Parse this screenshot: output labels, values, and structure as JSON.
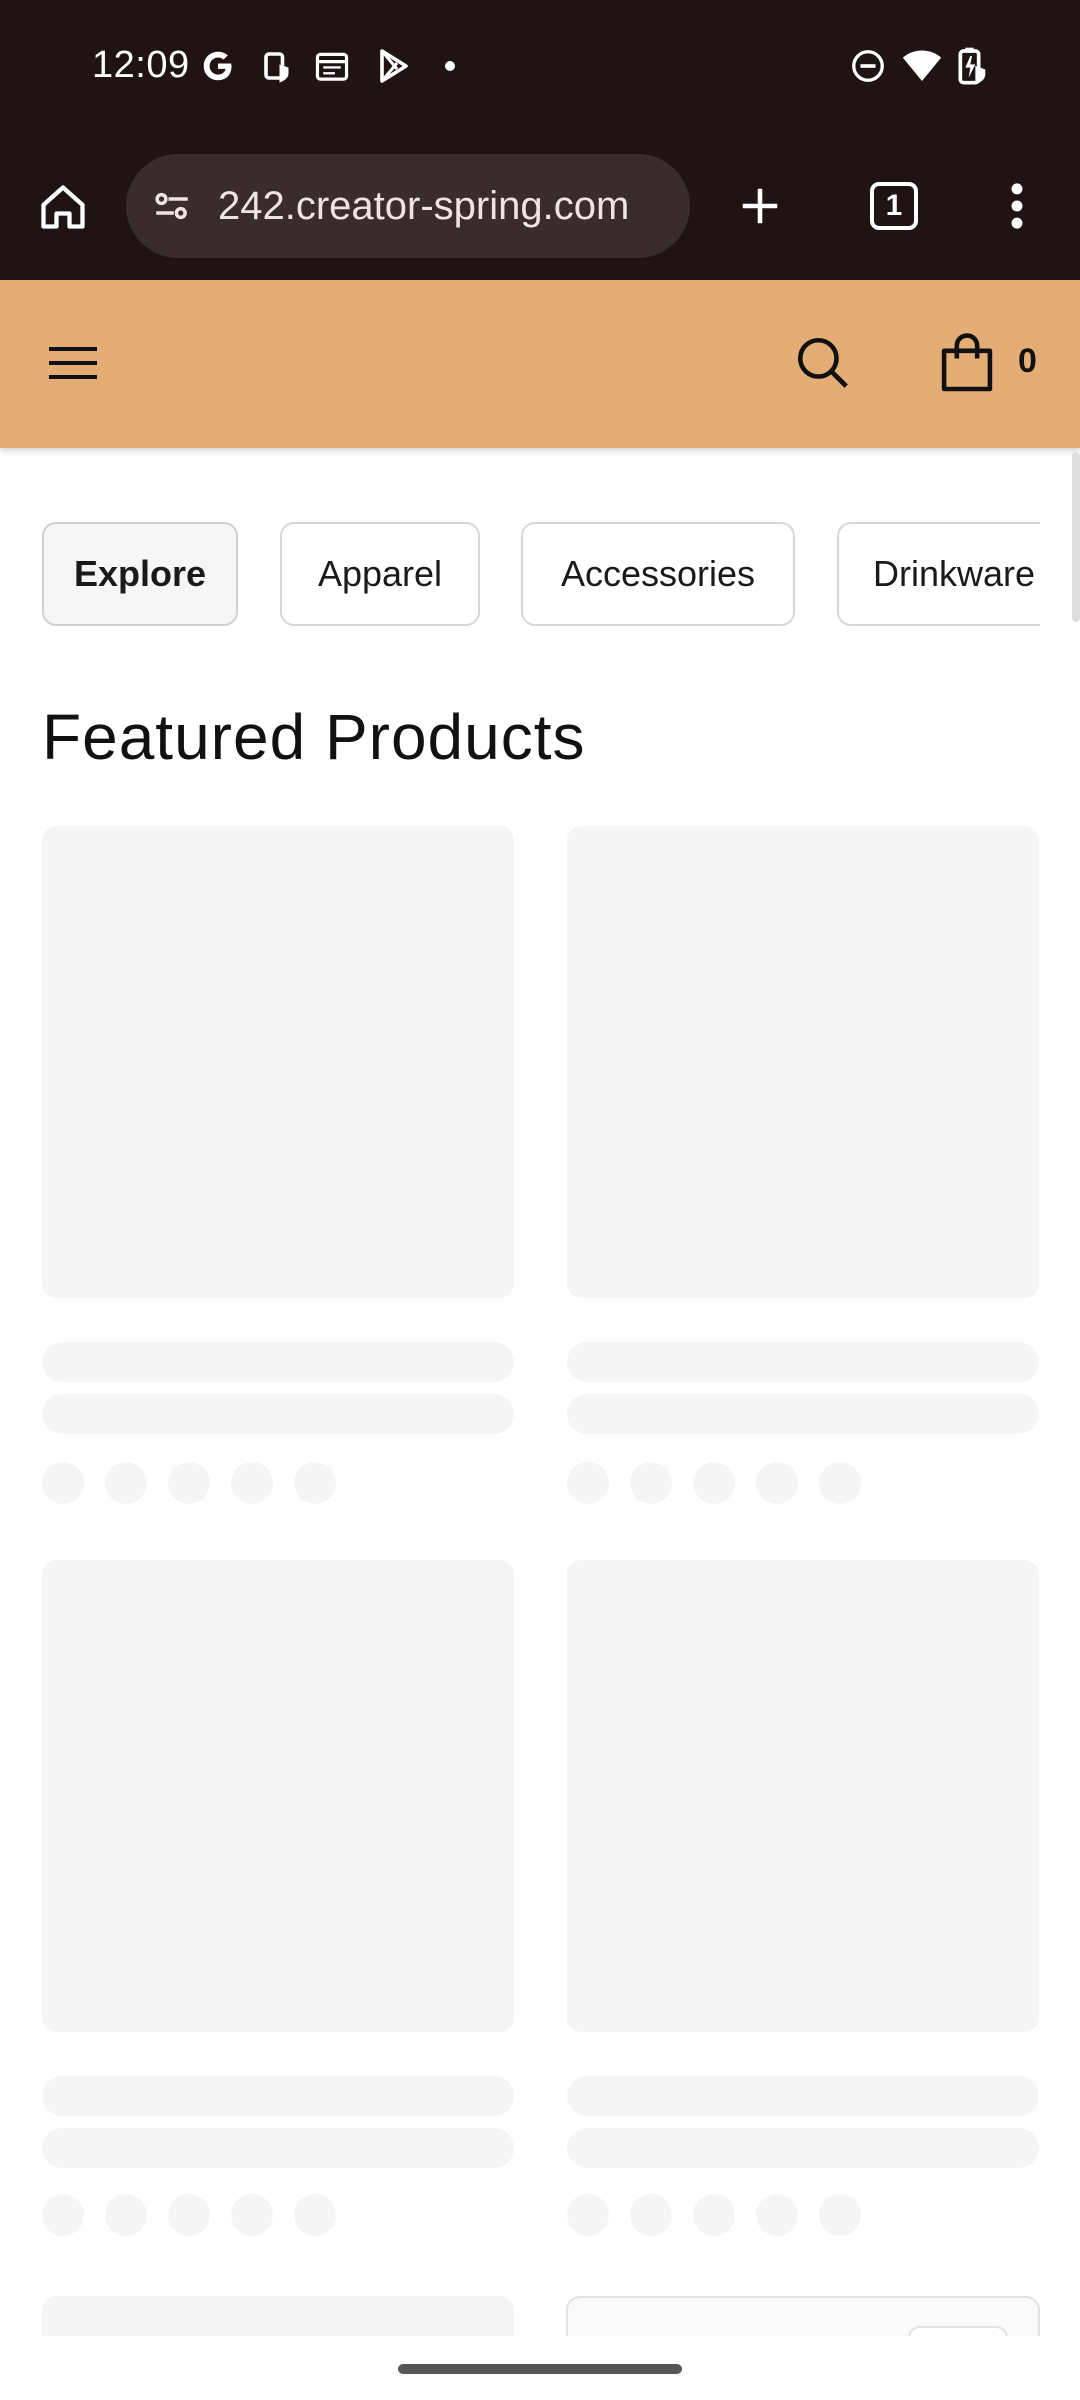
{
  "status_bar": {
    "time": "12:09",
    "left_icons": [
      "google-g-icon",
      "clipboard-shield-icon",
      "calendar-icon",
      "play-store-icon",
      "dot-icon"
    ],
    "right_icons": [
      "do-not-disturb-icon",
      "wifi-icon",
      "battery-charging-icon"
    ]
  },
  "browser": {
    "url": "242.creator-spring.com",
    "tab_count": "1"
  },
  "site_header": {
    "cart_count": "0"
  },
  "categories": [
    {
      "label": "Explore",
      "active": true
    },
    {
      "label": "Apparel",
      "active": false
    },
    {
      "label": "Accessories",
      "active": false
    },
    {
      "label": "Drinkware",
      "active": false
    }
  ],
  "featured": {
    "title": "Featured Products",
    "cards_loading": 4
  },
  "colors": {
    "status_bar_bg": "#1f1314",
    "header_bg": "#e5ad76",
    "skeleton": "#f5f5f5"
  }
}
